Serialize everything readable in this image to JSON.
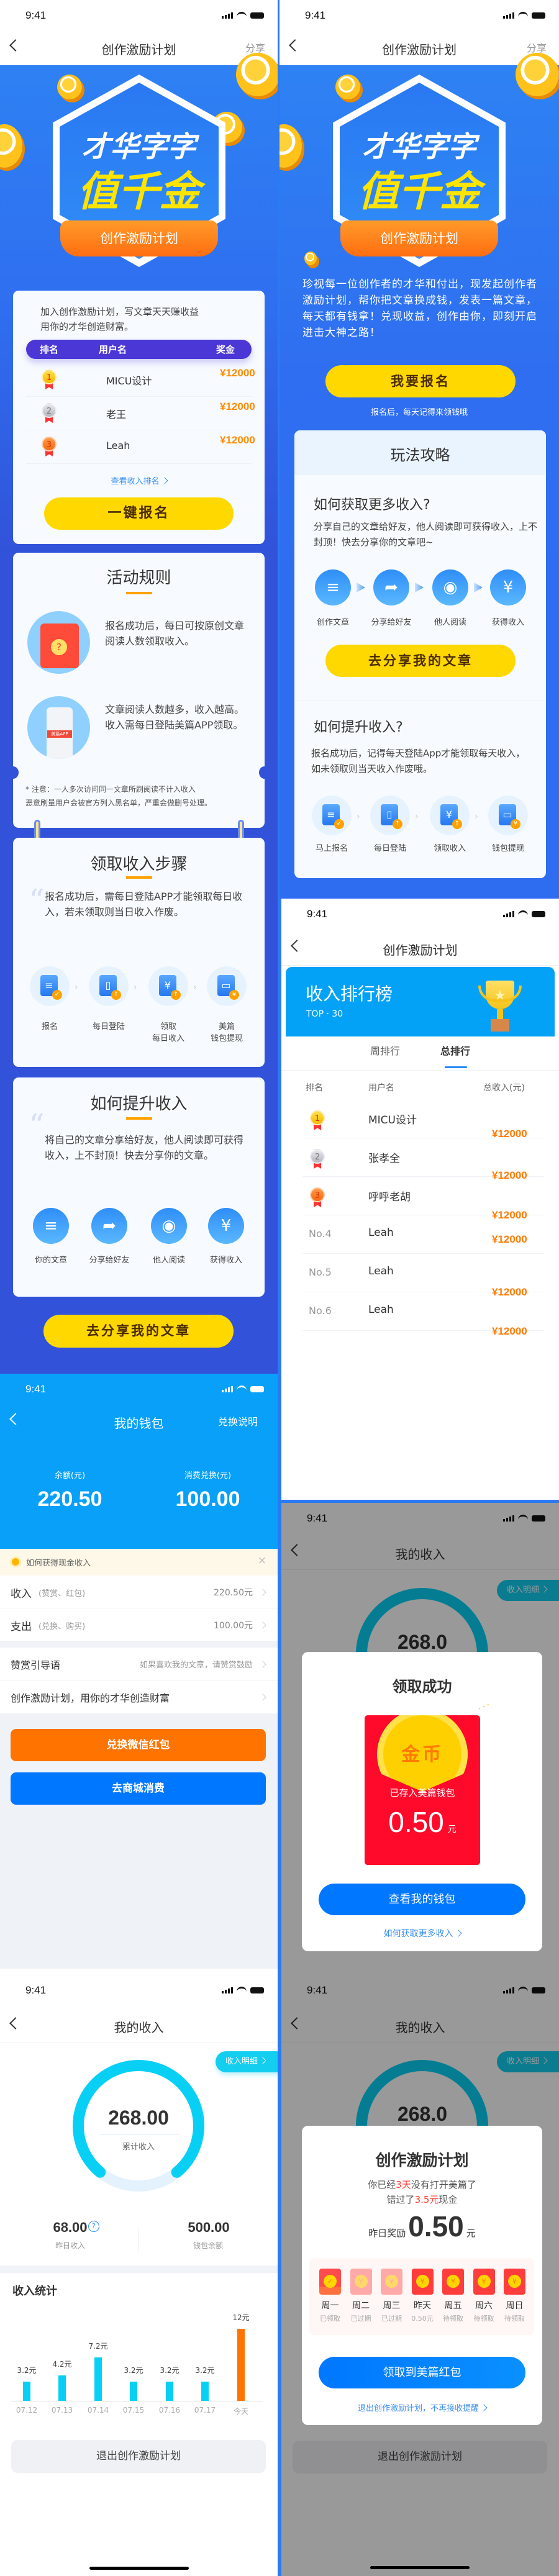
{
  "status_time": "9:41",
  "colors": {
    "primary_blue": "#2f6ef0",
    "yellow": "#ffd800",
    "orange": "#ff7300",
    "cyan": "#08d0f5",
    "red": "#ff0a2a"
  },
  "home_a": {
    "nav": {
      "title": "创作激励计划",
      "share": "分享"
    },
    "hero": {
      "line1": "才华字字",
      "line2": "值千金",
      "ribbon": "创作激励计划"
    },
    "ranking_card": {
      "intro": "加入创作激励计划，写文章天天赚收益\n用你的才华创造财富。",
      "headers": [
        "排名",
        "用户名",
        "奖金"
      ],
      "rows": [
        {
          "rank": "1",
          "name": "MICU设计",
          "amount": "¥12000"
        },
        {
          "rank": "2",
          "name": "老王",
          "amount": "¥12000"
        },
        {
          "rank": "3",
          "name": "Leah",
          "amount": "¥12000"
        }
      ],
      "link": "查看收入排名",
      "button": "一键报名"
    },
    "rules": {
      "title": "活动规则",
      "items": [
        "报名成功后，每日可按原创文章阅读人数领取收入。",
        "文章阅读人数越多，收入越高。收入需每日登陆美篇APP领取。"
      ],
      "phone_badge": "美篇APP",
      "note": "* 注意：一人多次访问同一文章所刷阅读不计入收入\n恶意刷量用户会被官方列入黑名单，严重会做删号处理。"
    },
    "steps": {
      "title": "领取收入步骤",
      "text": "报名成功后，需每日登陆APP才能领取每日收入，若未领取则当日收入作废。",
      "items": [
        {
          "label": "报名",
          "icon": "clipboard-icon"
        },
        {
          "label": "每日登陆",
          "icon": "phone-icon"
        },
        {
          "label": "领取\n每日收入",
          "icon": "hand-money-icon"
        },
        {
          "label": "美篇\n钱包提现",
          "icon": "wallet-icon"
        }
      ]
    },
    "boost": {
      "title": "如何提升收入",
      "text": "将自己的文章分享给好友，他人阅读即可获得收入，上不封顶！快去分享你的文章。",
      "items": [
        {
          "label": "你的文章",
          "icon": "document-icon"
        },
        {
          "label": "分享给好友",
          "icon": "share-icon"
        },
        {
          "label": "他人阅读",
          "icon": "eye-icon"
        },
        {
          "label": "获得收入",
          "icon": "money-bag-icon"
        }
      ]
    },
    "share_button": "去分享我的文章"
  },
  "home_b": {
    "nav": {
      "title": "创作激励计划",
      "share": "分享"
    },
    "description": "珍视每一位创作者的才华和付出，现发起创作者激励计划，帮你把文章换成钱，发表一篇文章，每天都有钱拿！兑现收益，创作由你，即刻开启进击大神之路！",
    "signup_button": "我要报名",
    "signup_hint": "报名后，每天记得来领钱哦",
    "guide": {
      "title": "玩法攻略",
      "more_title": "如何获取更多收入?",
      "more_text": "分享自己的文章给好友，他人阅读即可获得收入，上不封顶！快去分享你的文章吧~",
      "more_items": [
        "创作文章",
        "分享给好友",
        "他人阅读",
        "获得收入"
      ],
      "share_button": "去分享我的文章",
      "boost_title": "如何提升收入?",
      "boost_text": "报名成功后，记得每天登陆App才能领取每天收入，如未领取则当天收入作废哦。",
      "boost_items": [
        "马上报名",
        "每日登陆",
        "领取收入",
        "钱包提现"
      ]
    }
  },
  "ranking": {
    "nav_title": "创作激励计划",
    "banner_title": "收入排行榜",
    "banner_sub": "TOP · 30",
    "tabs": [
      "周排行",
      "总排行"
    ],
    "active_tab": 1,
    "headers": [
      "排名",
      "用户名",
      "总收入(元)"
    ],
    "rows": [
      {
        "rank": "1",
        "name": "MICU设计",
        "amount": "¥12000"
      },
      {
        "rank": "2",
        "name": "张孝全",
        "amount": "¥12000"
      },
      {
        "rank": "3",
        "name": "呼呼老胡",
        "amount": "¥12000"
      },
      {
        "rank": "No.4",
        "name": "Leah",
        "amount": "¥12000"
      },
      {
        "rank": "No.5",
        "name": "Leah",
        "amount": "¥12000"
      },
      {
        "rank": "No.6",
        "name": "Leah",
        "amount": "¥12000"
      }
    ]
  },
  "wallet": {
    "nav_title": "我的钱包",
    "nav_right": "兑换说明",
    "balance_label": "余额(元)",
    "balance": "220.50",
    "consume_label": "消费兑换(元)",
    "consume": "100.00",
    "tip": "如何获得现金收入",
    "rows": [
      {
        "label": "收入",
        "sub": "(赞赏、红包)",
        "value": "220.50元"
      },
      {
        "label": "支出",
        "sub": "(兑换、购买)",
        "value": "100.00元"
      }
    ],
    "reward_label": "赞赏引导语",
    "reward_value": "如果喜欢我的文章，请赞赏鼓励",
    "plan_row": "创作激励计划，用你的才华创造财富",
    "exchange_button": "兑换微信红包",
    "shop_button": "去商城消费"
  },
  "income": {
    "nav_title": "我的收入",
    "detail_pill": "收入明细",
    "total": "268.00",
    "total_label": "累计收入",
    "gauge_fill": 0.78,
    "yesterday": "68.00",
    "yesterday_label": "昨日收入",
    "wallet_balance": "500.00",
    "wallet_label": "钱包余额",
    "stats_title": "收入统计",
    "exit_button": "退出创作激励计划"
  },
  "chart_data": {
    "type": "bar",
    "categories": [
      "07.12",
      "07.13",
      "07.14",
      "07.15",
      "07.16",
      "07.17",
      "今天"
    ],
    "values": [
      3.2,
      4.2,
      7.2,
      3.2,
      3.2,
      3.2,
      12
    ],
    "data_labels": [
      "3.2元",
      "4.2元",
      "7.2元",
      "3.2元",
      "3.2元",
      "3.2元",
      "12元"
    ],
    "bar_colors": [
      "#08d0f5",
      "#08d0f5",
      "#08d0f5",
      "#08d0f5",
      "#08d0f5",
      "#08d0f5",
      "#ff7300"
    ],
    "grid": false
  },
  "modal_success": {
    "bg_title": "我的收入",
    "bg_pill": "收入明细",
    "bg_total": "268.0",
    "title": "领取成功",
    "coin_text": "金币",
    "saved_text": "已存入美篇钱包",
    "amount": "0.50",
    "unit": "元",
    "button": "查看我的钱包",
    "link": "如何获取更多收入"
  },
  "modal_reminder": {
    "bg_title": "我的收入",
    "bg_pill": "收入明细",
    "bg_total": "268.0",
    "bg_exit": "退出创作激励计划",
    "title": "创作激励计划",
    "line1_a": "你已经",
    "line1_hl": "3天",
    "line1_b": "没有打开美篇了",
    "line2_a": "错过了",
    "line2_hl": "3.5元",
    "line2_b": "现金",
    "reward_label": "昨日奖励",
    "amount": "0.50",
    "unit": "元",
    "days": [
      {
        "day": "周一",
        "status": "已领取",
        "state": "claimed"
      },
      {
        "day": "周二",
        "status": "已过期",
        "state": "expired"
      },
      {
        "day": "周三",
        "status": "已过期",
        "state": "expired"
      },
      {
        "day": "昨天",
        "status": "0.50元",
        "state": "available"
      },
      {
        "day": "周五",
        "status": "待领取",
        "state": "pending"
      },
      {
        "day": "周六",
        "status": "待领取",
        "state": "pending"
      },
      {
        "day": "周日",
        "status": "待领取",
        "state": "pending"
      }
    ],
    "button": "领取到美篇红包",
    "link": "退出创作激励计划，不再接收提醒"
  }
}
